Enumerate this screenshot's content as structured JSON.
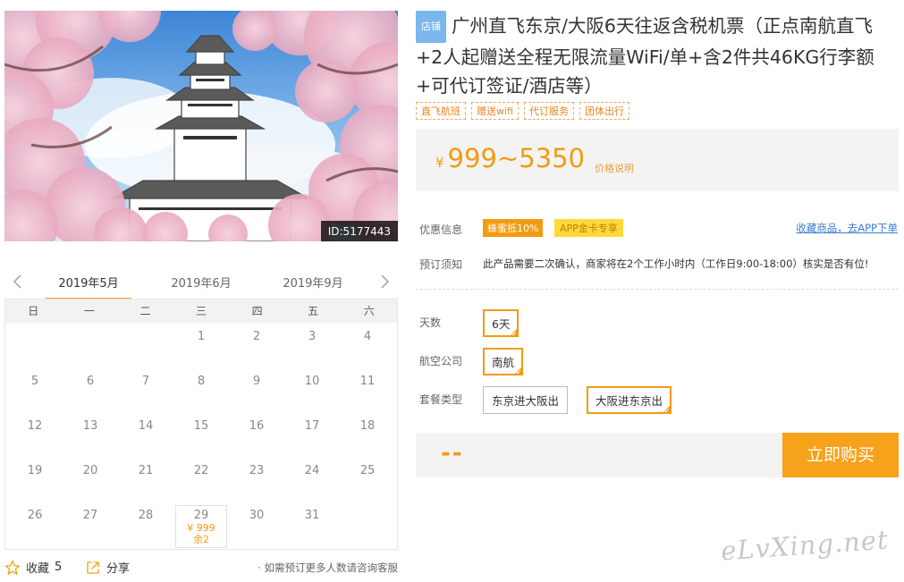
{
  "product": {
    "photo_id": "ID:5177443",
    "shop_badge": "店铺",
    "title": "广州直飞东京/大阪6天往返含税机票（正点南航直飞+2人起赠送全程无限流量WiFi/单+含2件共46KG行李额+可代订签证/酒店等）",
    "tags": [
      "直飞航班",
      "赠送wifi",
      "代订服务",
      "团体出行"
    ],
    "price_currency": "¥",
    "price_range": "999~5350",
    "price_note": "价格说明"
  },
  "calendar": {
    "months": [
      "2019年5月",
      "2019年6月",
      "2019年9月"
    ],
    "active_month": "2019年5月",
    "weekdays": [
      "日",
      "一",
      "二",
      "三",
      "四",
      "五",
      "六"
    ],
    "days": [
      "1",
      "2",
      "3",
      "4",
      "5",
      "6",
      "7",
      "8",
      "9",
      "10",
      "11",
      "12",
      "13",
      "14",
      "15",
      "16",
      "17",
      "18",
      "19",
      "20",
      "21",
      "22",
      "23",
      "24",
      "25",
      "26",
      "27",
      "28",
      "29",
      "30",
      "31"
    ],
    "highlight": {
      "day": "29",
      "price": "¥ 999",
      "remain": "余2"
    }
  },
  "social": {
    "collect_label": "收藏",
    "collect_count": "5",
    "share_label": "分享",
    "note": "· 如需预订更多人数请咨询客服"
  },
  "promo": {
    "label": "优惠信息",
    "tag_a": "蜂蜜抵10%",
    "tag_b": "APP金卡专享",
    "fav_link": "收藏商品，去APP下单"
  },
  "booking_notice": {
    "label": "预订须知",
    "text": "此产品需要二次确认，商家将在2个工作小时内（工作日9:00-18:00）核实是否有位!"
  },
  "options": {
    "days_label": "天数",
    "days_value": "6天",
    "airline_label": "航空公司",
    "airline_value": "南航",
    "package_label": "套餐类型",
    "package_choices": [
      "东京进大阪出",
      "大阪进东京出"
    ],
    "package_selected": "大阪进东京出"
  },
  "buy": {
    "total": "--",
    "button": "立即购买"
  },
  "watermark": "eLvXing.net",
  "colors": {
    "accent": "#f29b12",
    "link": "#3a7ed0",
    "badge": "#7bb6ee"
  }
}
